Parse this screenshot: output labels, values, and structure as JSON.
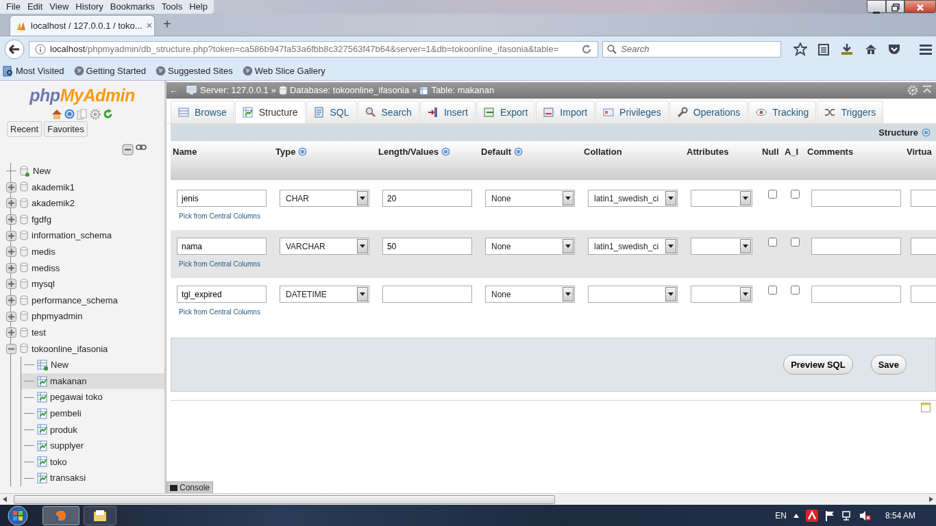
{
  "menu": [
    "File",
    "Edit",
    "View",
    "History",
    "Bookmarks",
    "Tools",
    "Help"
  ],
  "browser_tab": {
    "title": "localhost / 127.0.0.1 / toko...",
    "close": "×",
    "new_tab": "+"
  },
  "address": {
    "host": "localhost",
    "path": "/phpmyadmin/db_structure.php?token=ca586b947fa53a6fbb8c327563f47b64&server=1&db=tokoonline_ifasonia&table="
  },
  "search": {
    "placeholder": "Search"
  },
  "bookmarks": [
    "Most Visited",
    "Getting Started",
    "Suggested Sites",
    "Web Slice Gallery"
  ],
  "sidebar": {
    "logo": {
      "php": "php",
      "brand": "MyAdmin"
    },
    "buttons": [
      "Recent",
      "Favorites"
    ],
    "tree": [
      {
        "label": "New",
        "kind": "new"
      },
      {
        "label": "akademik1",
        "kind": "database",
        "expanded": false
      },
      {
        "label": "akademik2",
        "kind": "database",
        "expanded": false
      },
      {
        "label": "fgdfg",
        "kind": "database",
        "expanded": false
      },
      {
        "label": "information_schema",
        "kind": "database",
        "expanded": false
      },
      {
        "label": "medis",
        "kind": "database",
        "expanded": false
      },
      {
        "label": "mediss",
        "kind": "database",
        "expanded": false
      },
      {
        "label": "mysql",
        "kind": "database",
        "expanded": false
      },
      {
        "label": "performance_schema",
        "kind": "database",
        "expanded": false
      },
      {
        "label": "phpmyadmin",
        "kind": "database",
        "expanded": false
      },
      {
        "label": "test",
        "kind": "database",
        "expanded": false
      },
      {
        "label": "tokoonline_ifasonia",
        "kind": "database",
        "expanded": true,
        "children": [
          {
            "label": "New",
            "kind": "new_table"
          },
          {
            "label": "makanan",
            "kind": "table",
            "selected": true
          },
          {
            "label": "pegawai toko",
            "kind": "table",
            "selected": false
          },
          {
            "label": "pembeli",
            "kind": "table",
            "selected": false
          },
          {
            "label": "produk",
            "kind": "table",
            "selected": false
          },
          {
            "label": "supplyer",
            "kind": "table",
            "selected": false
          },
          {
            "label": "toko",
            "kind": "table",
            "selected": false
          },
          {
            "label": "transaksi",
            "kind": "table",
            "selected": false
          }
        ]
      }
    ]
  },
  "breadcrumb": {
    "back": "←",
    "separator": "»",
    "items": [
      "Server: 127.0.0.1",
      "Database: tokoonline_ifasonia",
      "Table: makanan"
    ]
  },
  "tabs": [
    {
      "label": "Browse",
      "selected": false
    },
    {
      "label": "Structure",
      "selected": true
    },
    {
      "label": "SQL",
      "selected": false
    },
    {
      "label": "Search",
      "selected": false
    },
    {
      "label": "Insert",
      "selected": false
    },
    {
      "label": "Export",
      "selected": false
    },
    {
      "label": "Import",
      "selected": false
    },
    {
      "label": "Privileges",
      "selected": false
    },
    {
      "label": "Operations",
      "selected": false
    },
    {
      "label": "Tracking",
      "selected": false
    },
    {
      "label": "Triggers",
      "selected": false
    }
  ],
  "section_title": "Structure",
  "columns": [
    {
      "label": "Name",
      "help": false
    },
    {
      "label": "Type",
      "help": true
    },
    {
      "label": "Length/Values",
      "help": true
    },
    {
      "label": "Default",
      "help": true
    },
    {
      "label": "Collation",
      "help": false
    },
    {
      "label": "Attributes",
      "help": false
    },
    {
      "label": "Null",
      "help": false
    },
    {
      "label": "A_I",
      "help": false
    },
    {
      "label": "Comments",
      "help": false
    },
    {
      "label": "Virtua",
      "help": false
    }
  ],
  "rows": [
    {
      "name": "jenis",
      "type": "CHAR",
      "length": "20",
      "default": "None",
      "collation": "latin1_swedish_ci",
      "null": false,
      "ai": false,
      "link": "Pick from Central Columns"
    },
    {
      "name": "nama",
      "type": "VARCHAR",
      "length": "50",
      "default": "None",
      "collation": "latin1_swedish_ci",
      "null": false,
      "ai": false,
      "link": "Pick from Central Columns"
    },
    {
      "name": "tgl_expired",
      "type": "DATETIME",
      "default": "None",
      "null": false,
      "ai": false,
      "link": "Pick from Central Columns"
    }
  ],
  "buttons": [
    "Preview SQL",
    "Save"
  ],
  "console": "Console",
  "taskbar": {
    "language": "EN",
    "time": "8:54 AM"
  }
}
